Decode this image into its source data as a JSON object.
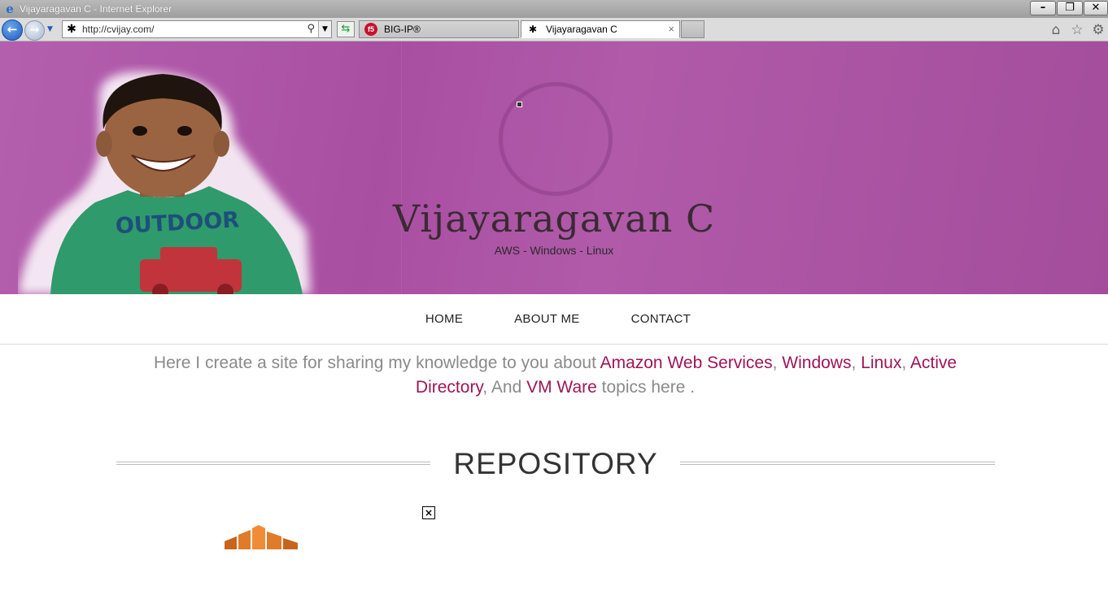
{
  "window": {
    "title": "Vijayaragavan C - Internet Explorer",
    "minimize": "–",
    "restore": "❐",
    "close": "✕"
  },
  "browser": {
    "url": "http://cvijay.com/",
    "tabs": [
      {
        "label": "BIG-IP®",
        "active": false,
        "icon": "f5-icon"
      },
      {
        "label": "Vijayaragavan C",
        "active": true,
        "icon": "site-favicon-icon"
      }
    ]
  },
  "hero": {
    "title": "Vijayaragavan C",
    "tagline": "AWS - Windows - Linux",
    "background_color": "#ac54a5"
  },
  "menu": {
    "items": [
      "HOME",
      "ABOUT ME",
      "CONTACT"
    ]
  },
  "intro": {
    "prefix": "Here I create a site for sharing my knowledge to you about ",
    "link1": "Amazon Web Services",
    "sep1": ", ",
    "link2": "Windows",
    "sep2": ", ",
    "link3": "Linux",
    "sep3": ", ",
    "link4": "Active Directory",
    "sep4": ", And ",
    "link5": "VM Ware",
    "suffix": " topics here .",
    "link_color": "#a01458"
  },
  "repository": {
    "heading": "REPOSITORY"
  }
}
